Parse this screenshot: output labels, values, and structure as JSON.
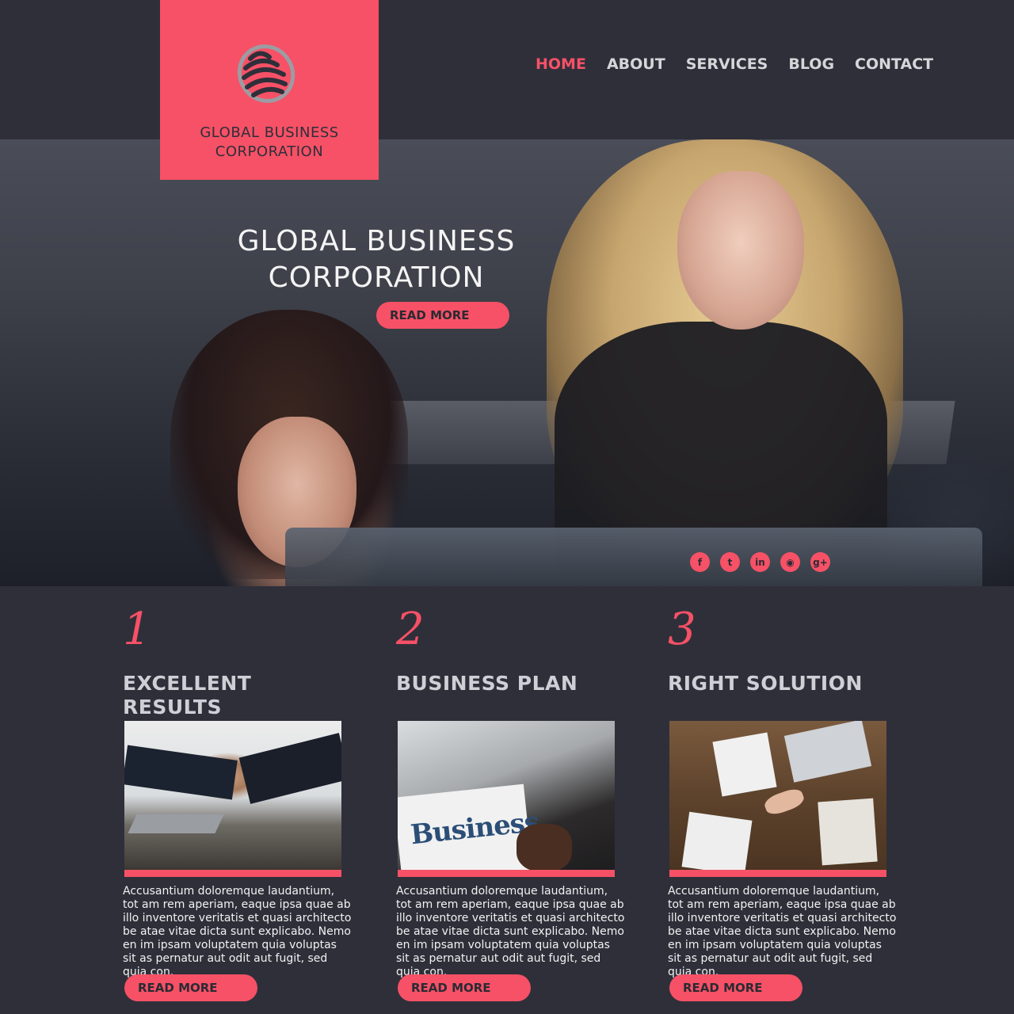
{
  "brand": {
    "logo_line1": "GLOBAL BUSINESS",
    "logo_line2": "CORPORATION"
  },
  "nav": {
    "items": [
      {
        "label": "HOME",
        "active": true
      },
      {
        "label": "ABOUT",
        "active": false
      },
      {
        "label": "SERVICES",
        "active": false
      },
      {
        "label": "BLOG",
        "active": false
      },
      {
        "label": "CONTACT",
        "active": false
      }
    ]
  },
  "hero": {
    "title_line1": "GLOBAL BUSINESS",
    "title_line2": "CORPORATION",
    "button_label": "READ MORE",
    "socials": [
      {
        "icon": "facebook-icon",
        "glyph": "f"
      },
      {
        "icon": "twitter-icon",
        "glyph": "t"
      },
      {
        "icon": "linkedin-icon",
        "glyph": "in"
      },
      {
        "icon": "rss-icon",
        "glyph": "◉"
      },
      {
        "icon": "google-plus-icon",
        "glyph": "g+"
      }
    ]
  },
  "features": [
    {
      "number": "1",
      "heading": "EXCELLENT RESULTS",
      "text": "Accusantium doloremque laudantium, tot am rem aperiam, eaque ipsa quae ab illo inventore veritatis et quasi architecto be atae vitae dicta sunt explicabo. Nemo en im ipsam voluptatem quia voluptas sit as pernatur aut odit aut fugit, sed quia con.",
      "button_label": "READ MORE"
    },
    {
      "number": "2",
      "heading": "BUSINESS PLAN",
      "photo_word": "Business",
      "text": "Accusantium doloremque laudantium, tot am rem aperiam, eaque ipsa quae ab illo inventore veritatis et quasi architecto be atae vitae dicta sunt explicabo. Nemo en im ipsam voluptatem quia voluptas sit as pernatur aut odit aut fugit, sed quia con.",
      "button_label": "READ MORE"
    },
    {
      "number": "3",
      "heading": "RIGHT SOLUTION",
      "text": "Accusantium doloremque laudantium, tot am rem aperiam, eaque ipsa quae ab illo inventore veritatis et quasi architecto be atae vitae dicta sunt explicabo. Nemo en im ipsam voluptatem quia voluptas sit as pernatur aut odit aut fugit, sed quia con.",
      "button_label": "READ MORE"
    }
  ],
  "colors": {
    "accent": "#f65166",
    "background": "#2f2f3a",
    "heading_text": "#cfcfd6"
  }
}
